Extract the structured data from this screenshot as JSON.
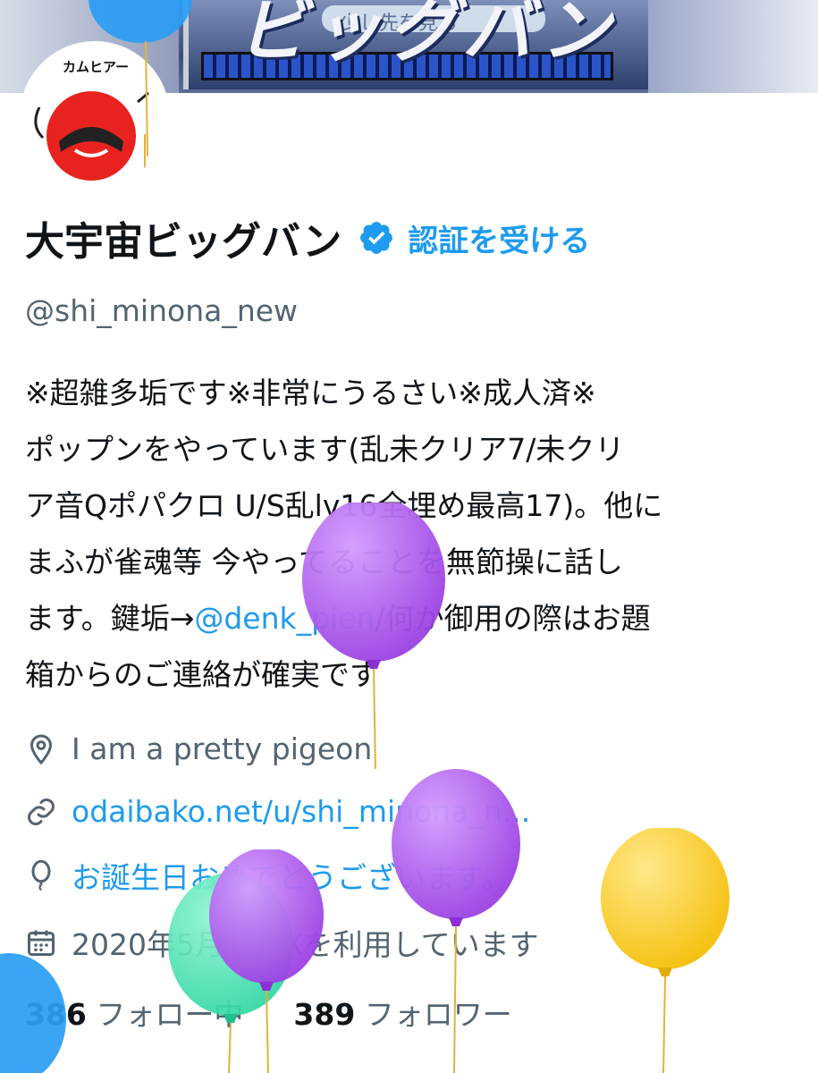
{
  "banner": {
    "title": "ビッグバン",
    "caption": "少し先を見る"
  },
  "avatar": {
    "label": "カムヒアー"
  },
  "profile": {
    "display_name": "大宇宙ビッグバン",
    "get_verified": "認証を受ける",
    "handle": "@shi_minona_new",
    "bio_lines": [
      "※超雑多垢です※非常にうるさい※成人済※",
      "ポップンをやっています(乱未クリア7/未クリ",
      "ア音Qポパクロ U/S乱lv16全埋め最高17)。他に",
      "まふが雀魂等 今やってることを無節操に話し"
    ],
    "bio_line5_pre": "ます。鍵垢→",
    "bio_mention": "@denk_pien",
    "bio_line5_post": "/何か御用の際はお題",
    "bio_line6": "箱からのご連絡が確実です",
    "location": "I am a pretty pigeon",
    "website": "odaibako.net/u/shi_minona_n...",
    "birthday": "お誕生日おめでとうございます。",
    "joined": "2020年5月からXを利用しています",
    "following_count": "386",
    "following_label": "フォロー中",
    "followers_count": "389",
    "followers_label": "フォロワー"
  },
  "colors": {
    "accent": "#1d9bf0",
    "text": "#0f1419",
    "muted": "#536471",
    "balloon_purple": "#a855e8",
    "balloon_yellow": "#fcd12a",
    "balloon_green": "#3ee0b0",
    "balloon_blue": "#2a9df4"
  },
  "icons": [
    "verified-badge-icon",
    "location-pin-icon",
    "link-icon",
    "balloon-icon",
    "calendar-icon",
    "chevron-right-icon"
  ]
}
